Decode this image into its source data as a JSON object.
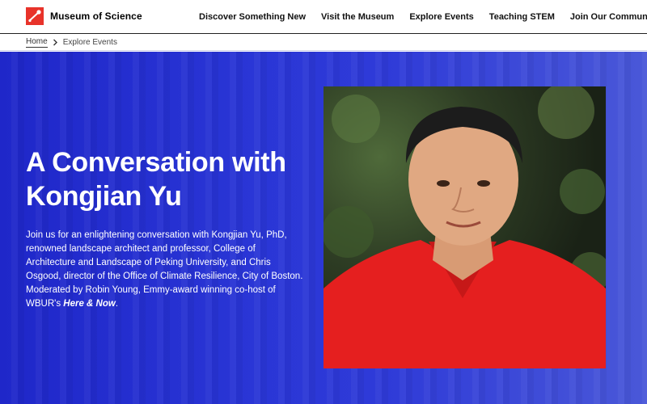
{
  "brand": {
    "name": "Museum of Science",
    "logo_color": "#e8332a"
  },
  "nav": {
    "items": [
      {
        "label": "Discover Something New"
      },
      {
        "label": "Visit the Museum"
      },
      {
        "label": "Explore Events"
      },
      {
        "label": "Teaching STEM"
      },
      {
        "label": "Join Our Community"
      }
    ]
  },
  "breadcrumb": {
    "home": "Home",
    "separator_icon": "chevron-right-icon",
    "current": "Explore Events"
  },
  "hero": {
    "background_color": "#2a36d6",
    "title": "A Conversation with Kongjian Yu",
    "description_main": "Join us for an enlightening conversation with Kongjian Yu, PhD, renowned landscape architect and professor, College of Architecture and Landscape of Peking University, and Chris Osgood, director of the Office of Climate Resilience, City of Boston. Moderated by Robin Young, Emmy-award winning co-host of WBUR's ",
    "description_emphasis": "Here & Now",
    "description_end": ".",
    "photo_alt": "Portrait of Kongjian Yu"
  }
}
